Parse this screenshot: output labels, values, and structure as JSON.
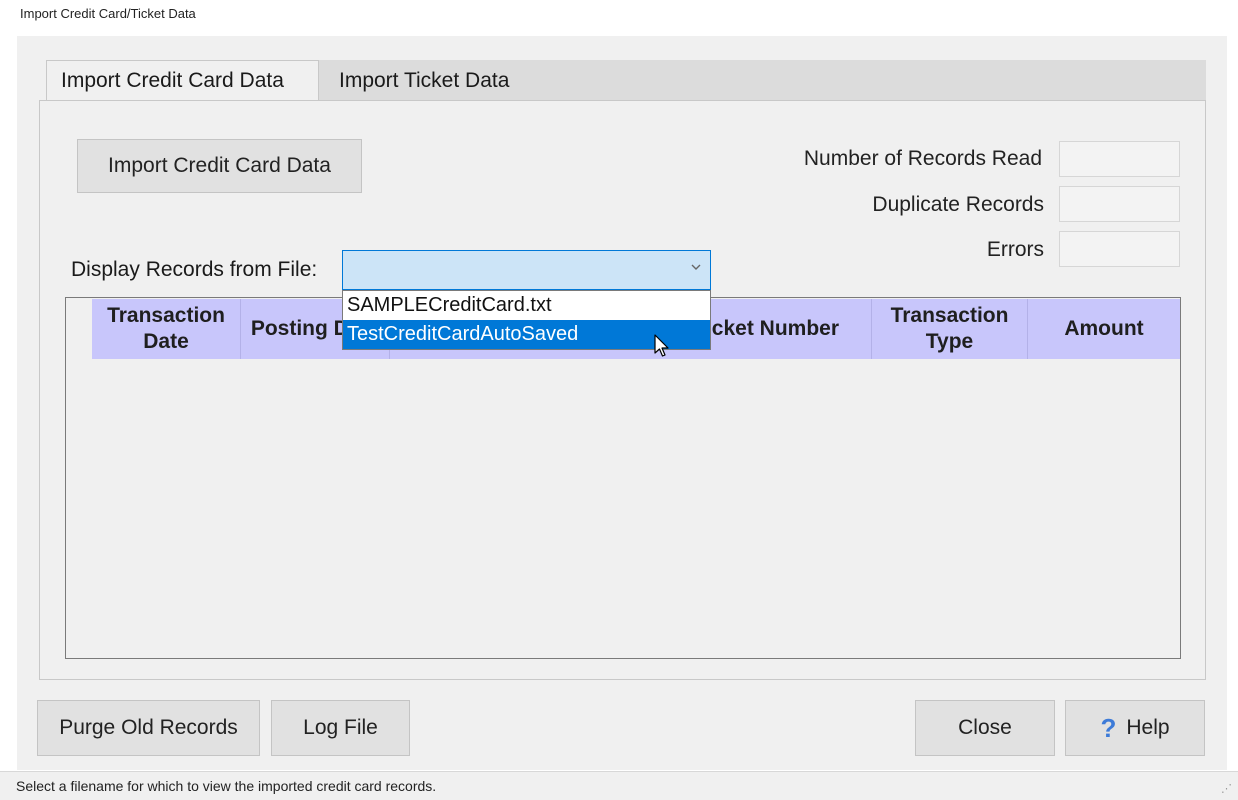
{
  "window": {
    "title": "Import Credit Card/Ticket Data"
  },
  "tabs": [
    {
      "label": "Import Credit Card Data",
      "active": true
    },
    {
      "label": "Import Ticket Data",
      "active": false
    }
  ],
  "import_button": {
    "label": "Import Credit Card Data"
  },
  "stats": {
    "records_read_label": "Number of Records Read",
    "records_read_value": "",
    "duplicates_label": "Duplicate Records",
    "duplicates_value": "",
    "errors_label": "Errors",
    "errors_value": ""
  },
  "file_select": {
    "label": "Display Records from File:",
    "value": "",
    "options": [
      "SAMPLECreditCard.txt",
      "TestCreditCardAutoSaved"
    ],
    "highlighted": "TestCreditCardAutoSaved"
  },
  "grid": {
    "columns": [
      {
        "label": "Transaction Date"
      },
      {
        "label": "Posting Date"
      },
      {
        "label": "Ticket Number"
      },
      {
        "label": "Transaction Type"
      },
      {
        "label": "Amount"
      }
    ]
  },
  "footer": {
    "purge_label": "Purge Old Records",
    "log_label": "Log File",
    "close_label": "Close",
    "help_label": "Help"
  },
  "status": {
    "text": "Select a filename for which to view the imported credit card records."
  },
  "colors": {
    "header_bg": "#c8c6fb",
    "selection": "#0078d7",
    "combo_bg": "#cce4f7"
  },
  "icons": {
    "help": "question-mark-icon",
    "combo": "chevron-down-icon",
    "cursor": "mouse-pointer-icon"
  }
}
